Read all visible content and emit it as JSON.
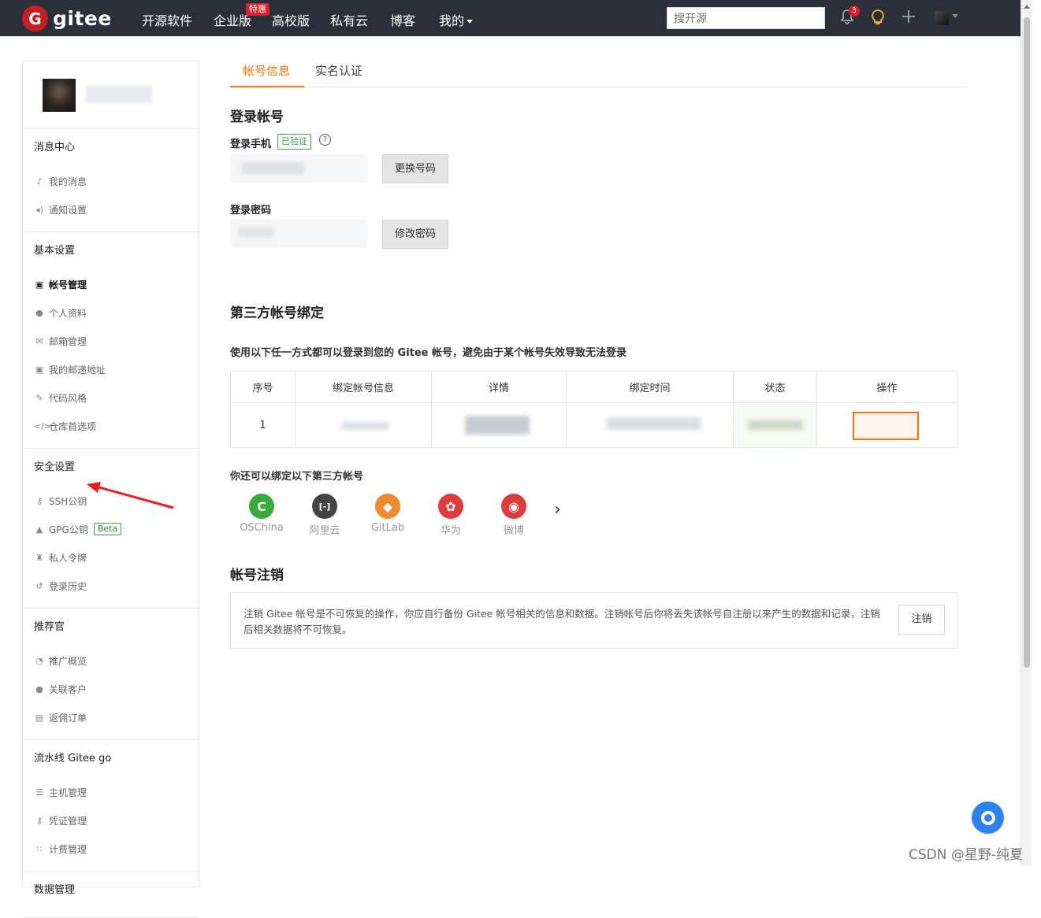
{
  "navbar": {
    "logo_letter": "G",
    "logo_text": "gitee",
    "items": [
      "开源软件",
      "企业版",
      "高校版",
      "私有云",
      "博客",
      "我的"
    ],
    "special_badge": "特惠",
    "search_placeholder": "搜开源",
    "notification_count": "3"
  },
  "sidebar": {
    "sections": [
      {
        "title": "消息中心",
        "items": [
          "我的消息",
          "通知设置"
        ]
      },
      {
        "title": "基本设置",
        "items": [
          "帐号管理",
          "个人资料",
          "邮箱管理",
          "我的邮递地址",
          "代码风格",
          "仓库首选项"
        ]
      },
      {
        "title": "安全设置",
        "items": [
          "SSH公钥",
          "GPG公钥",
          "私人令牌",
          "登录历史"
        ],
        "gpg_badge": "Beta"
      },
      {
        "title": "推荐官",
        "items": [
          "推广概览",
          "关联客户",
          "返佣订单"
        ]
      },
      {
        "title": "流水线 Gitee go",
        "items": [
          "主机管理",
          "凭证管理",
          "计费管理"
        ]
      },
      {
        "title": "数据管理",
        "items": []
      }
    ]
  },
  "tabs": [
    "帐号信息",
    "实名认证"
  ],
  "login": {
    "title": "登录帐号",
    "phone_label": "登录手机",
    "verified_badge": "已验证",
    "help_glyph": "?",
    "change_phone_button": "更换号码",
    "password_label": "登录密码",
    "change_password_button": "修改密码"
  },
  "third_party": {
    "title": "第三方帐号绑定",
    "note": "使用以下任一方式都可以登录到您的 Gitee 帐号，避免由于某个帐号失效导致无法登录",
    "columns": [
      "序号",
      "绑定帐号信息",
      "详情",
      "绑定时间",
      "状态",
      "操作"
    ],
    "rows": [
      {
        "index": "1"
      }
    ],
    "also_title": "你还可以绑定以下第三方帐号",
    "providers": [
      {
        "name": "OSChina",
        "glyph": "C",
        "color": "#3aab3a"
      },
      {
        "name": "阿里云",
        "glyph": "[-]",
        "color": "#444444"
      },
      {
        "name": "GitLab",
        "glyph": "◆",
        "color": "#f18a2a"
      },
      {
        "name": "华为",
        "glyph": "✿",
        "color": "#e23b3b"
      },
      {
        "name": "微博",
        "glyph": "◉",
        "color": "#e23b3b"
      }
    ],
    "next_glyph": "›"
  },
  "cancel": {
    "title": "帐号注销",
    "text": "注销 Gitee 帐号是不可恢复的操作，你应自行备份 Gitee 帐号相关的信息和数据。注销帐号后你将丢失该帐号自注册以来产生的数据和记录，注销后相关数据将不可恢复。",
    "button": "注销"
  },
  "watermark": "CSDN @星野-纯夏",
  "colors": {
    "navbar": "#2b2f3a",
    "accent": "#fe7300",
    "brand": "#c71d23",
    "verified": "#35a348"
  }
}
